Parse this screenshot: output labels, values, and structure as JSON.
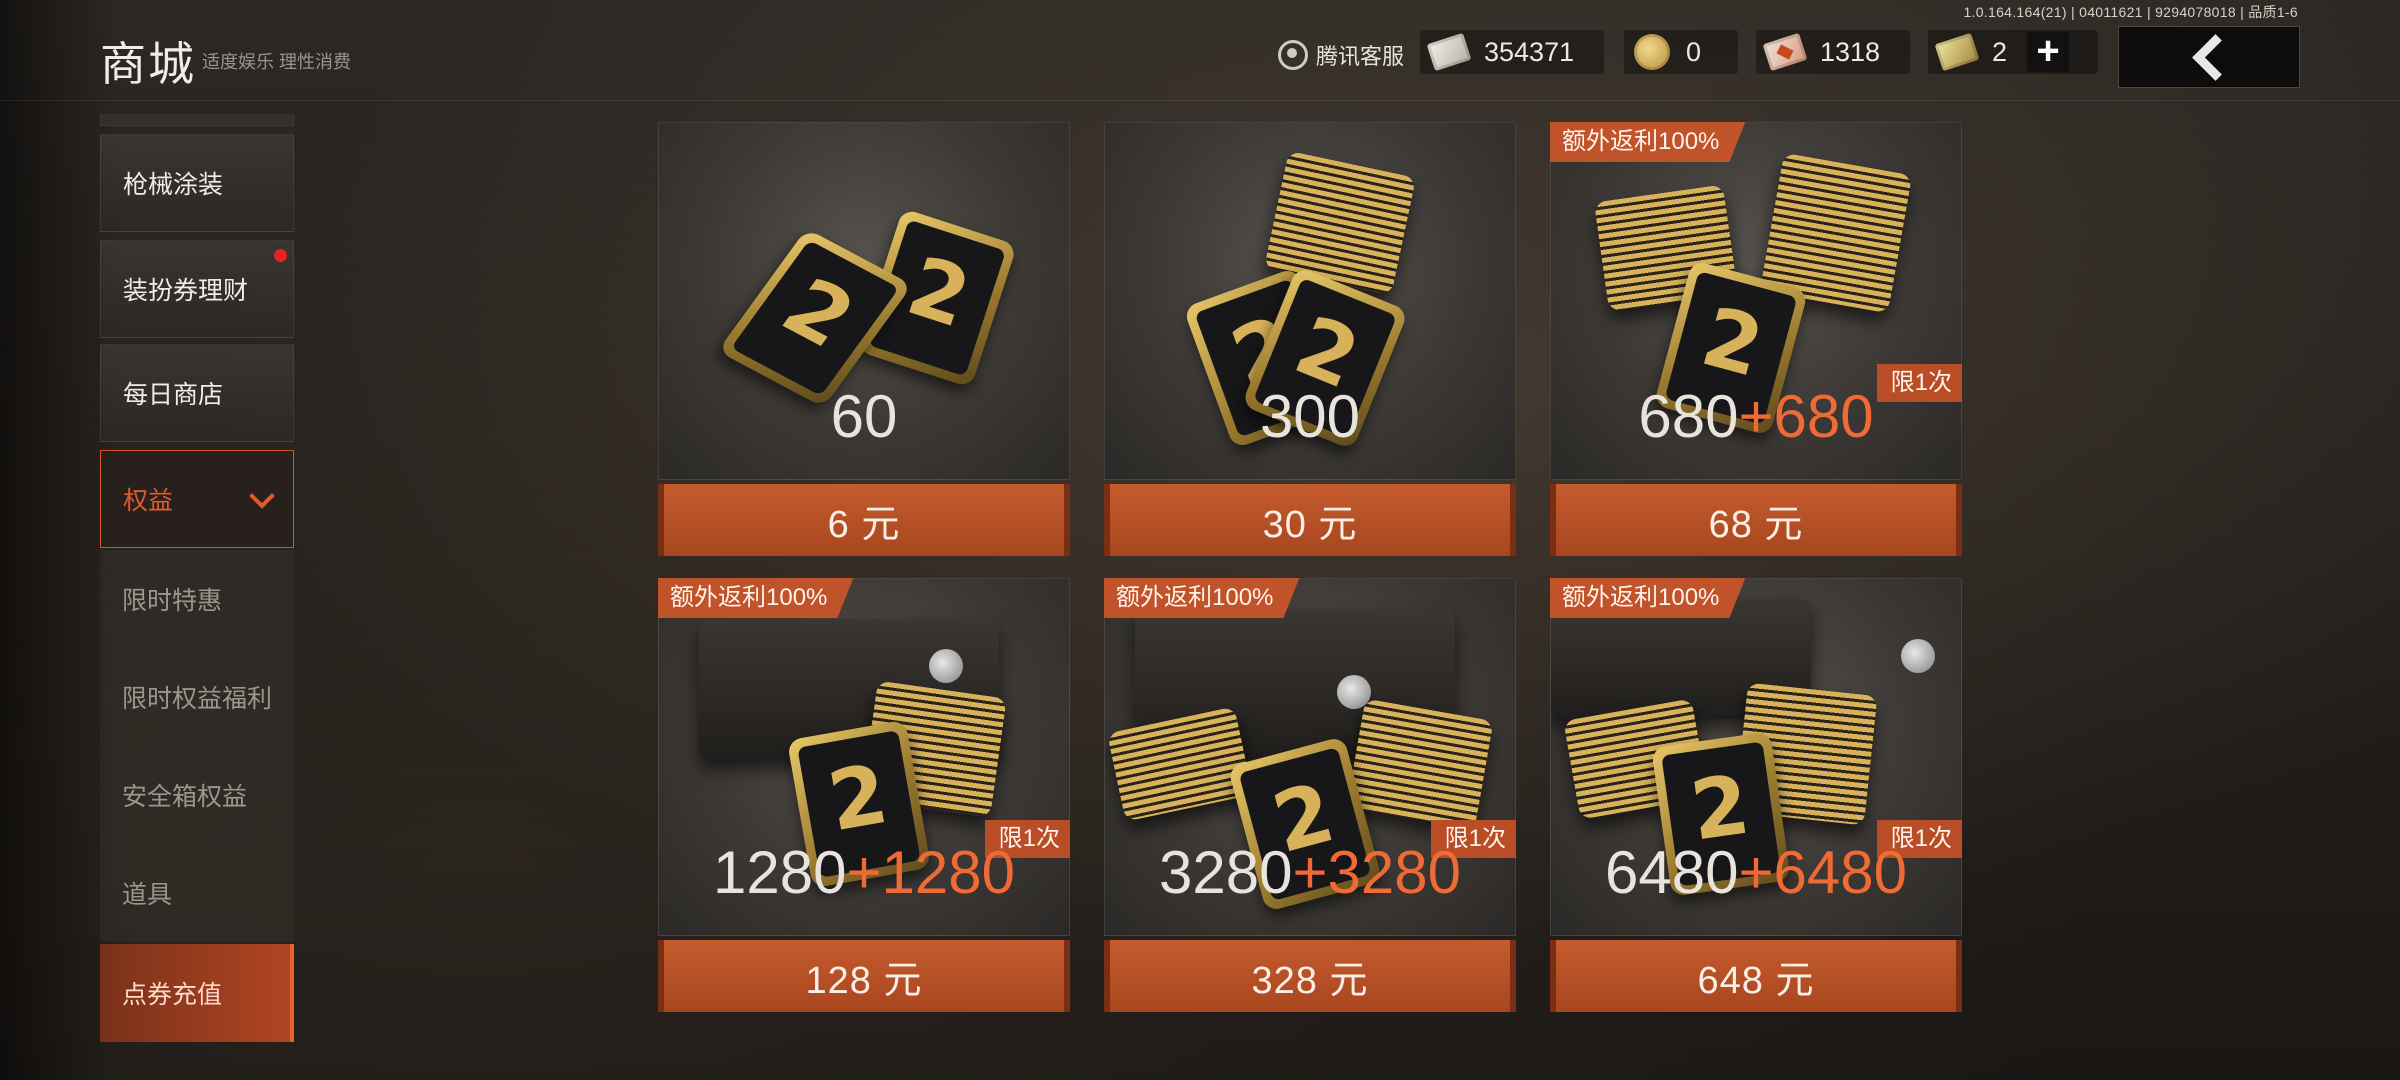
{
  "header": {
    "title": "商城",
    "subtitle": "适度娱乐 理性消费",
    "version_info": "1.0.164.164(21) | 04011621 | 9294078018 | 品质1-6",
    "service_label": "腾讯客服",
    "currencies": [
      {
        "icon": "ticket-icon",
        "value": "354371"
      },
      {
        "icon": "gold-coin-icon",
        "value": "0"
      },
      {
        "icon": "red-voucher-icon",
        "value": "1318"
      },
      {
        "icon": "gold-ticket-icon",
        "value": "2"
      }
    ],
    "plus_label": "+"
  },
  "sidebar": {
    "items": [
      {
        "label": "枪械涂装"
      },
      {
        "label": "装扮券理财",
        "badge": "red-dot"
      },
      {
        "label": "每日商店"
      },
      {
        "label": "权益",
        "expanded": true
      },
      {
        "label": "限时特惠"
      },
      {
        "label": "限时权益福利"
      },
      {
        "label": "安全箱权益"
      },
      {
        "label": "道具"
      },
      {
        "label": "点券充值",
        "selected": true
      }
    ]
  },
  "products": [
    {
      "amount": "60",
      "bonus": "",
      "bonus_tag": "",
      "limit_tag": "",
      "price": "6 元"
    },
    {
      "amount": "300",
      "bonus": "",
      "bonus_tag": "",
      "limit_tag": "",
      "price": "30 元"
    },
    {
      "amount": "680",
      "bonus": "+680",
      "bonus_tag": "额外返利100%",
      "limit_tag": "限1次",
      "price": "68 元"
    },
    {
      "amount": "1280",
      "bonus": "+1280",
      "bonus_tag": "额外返利100%",
      "limit_tag": "限1次",
      "price": "128 元"
    },
    {
      "amount": "3280",
      "bonus": "+3280",
      "bonus_tag": "额外返利100%",
      "limit_tag": "限1次",
      "price": "328 元"
    },
    {
      "amount": "6480",
      "bonus": "+6480",
      "bonus_tag": "额外返利100%",
      "limit_tag": "限1次",
      "price": "648 元"
    }
  ],
  "colors": {
    "accent": "#c45b2d",
    "bonus": "#f06a35",
    "badge_red": "#e0242a"
  }
}
